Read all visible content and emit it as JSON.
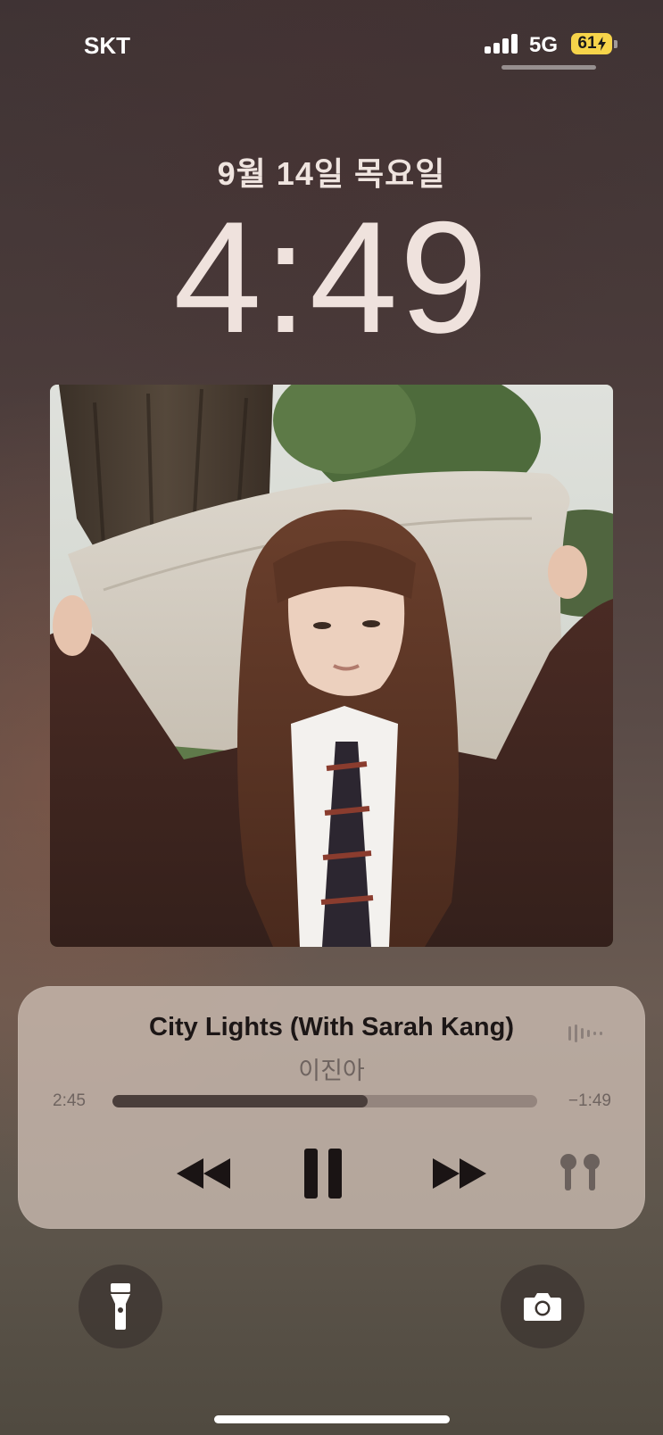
{
  "status_bar": {
    "carrier": "SKT",
    "network": "5G",
    "battery_level": "61",
    "battery_charging": true,
    "battery_color": "#f6d44a"
  },
  "lock_screen": {
    "date": "9월 14일 목요일",
    "time": "4:49"
  },
  "now_playing": {
    "title": "City Lights (With Sarah Kang)",
    "artist": "이진아",
    "elapsed": "2:45",
    "remaining": "−1:49",
    "progress_fraction": 0.6,
    "controls": [
      "rewind-icon",
      "pause-icon",
      "fast-forward-icon",
      "airpods-icon"
    ],
    "output_icon": "waveform-icon"
  },
  "shortcuts": {
    "left": "flashlight-icon",
    "right": "camera-icon"
  }
}
